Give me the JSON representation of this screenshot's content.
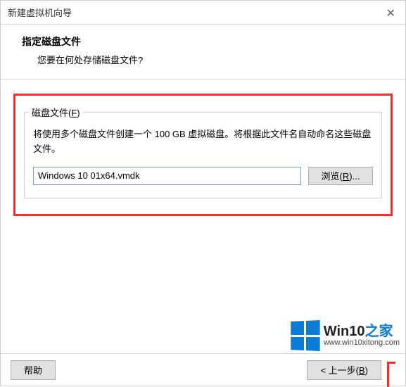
{
  "titlebar": {
    "title": "新建虚拟机向导"
  },
  "header": {
    "title": "指定磁盘文件",
    "subtitle": "您要在何处存储磁盘文件?"
  },
  "group": {
    "legend_prefix": "磁盘文件(",
    "legend_key": "F",
    "legend_suffix": ")",
    "description": "将使用多个磁盘文件创建一个 100 GB 虚拟磁盘。将根据此文件名自动命名这些磁盘文件。",
    "file_value": "Windows 10 01x64.vmdk",
    "browse_prefix": "浏览(",
    "browse_key": "R",
    "browse_suffix": ")..."
  },
  "buttons": {
    "help": "帮助",
    "back_prefix": "< 上一步(",
    "back_key": "B",
    "back_suffix": ")"
  },
  "watermark": {
    "brand_a": "Win10",
    "brand_b": "之家",
    "url": "www.win10xitong.com"
  }
}
